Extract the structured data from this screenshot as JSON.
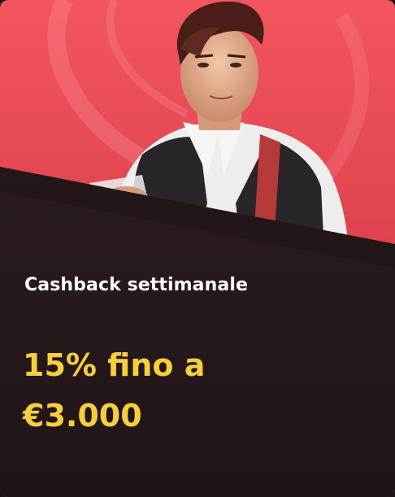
{
  "promo": {
    "title": "Cashback settimanale",
    "amount_line1": "15% fino a",
    "amount_line2": "€3.000"
  },
  "colors": {
    "banner_top": "#f2555e",
    "banner_bottom": "#b9263a",
    "card_bg": "#241719",
    "title": "#ffffff",
    "accent": "#f7cf3c"
  },
  "icons": {
    "hero": "croupier-illustration"
  }
}
